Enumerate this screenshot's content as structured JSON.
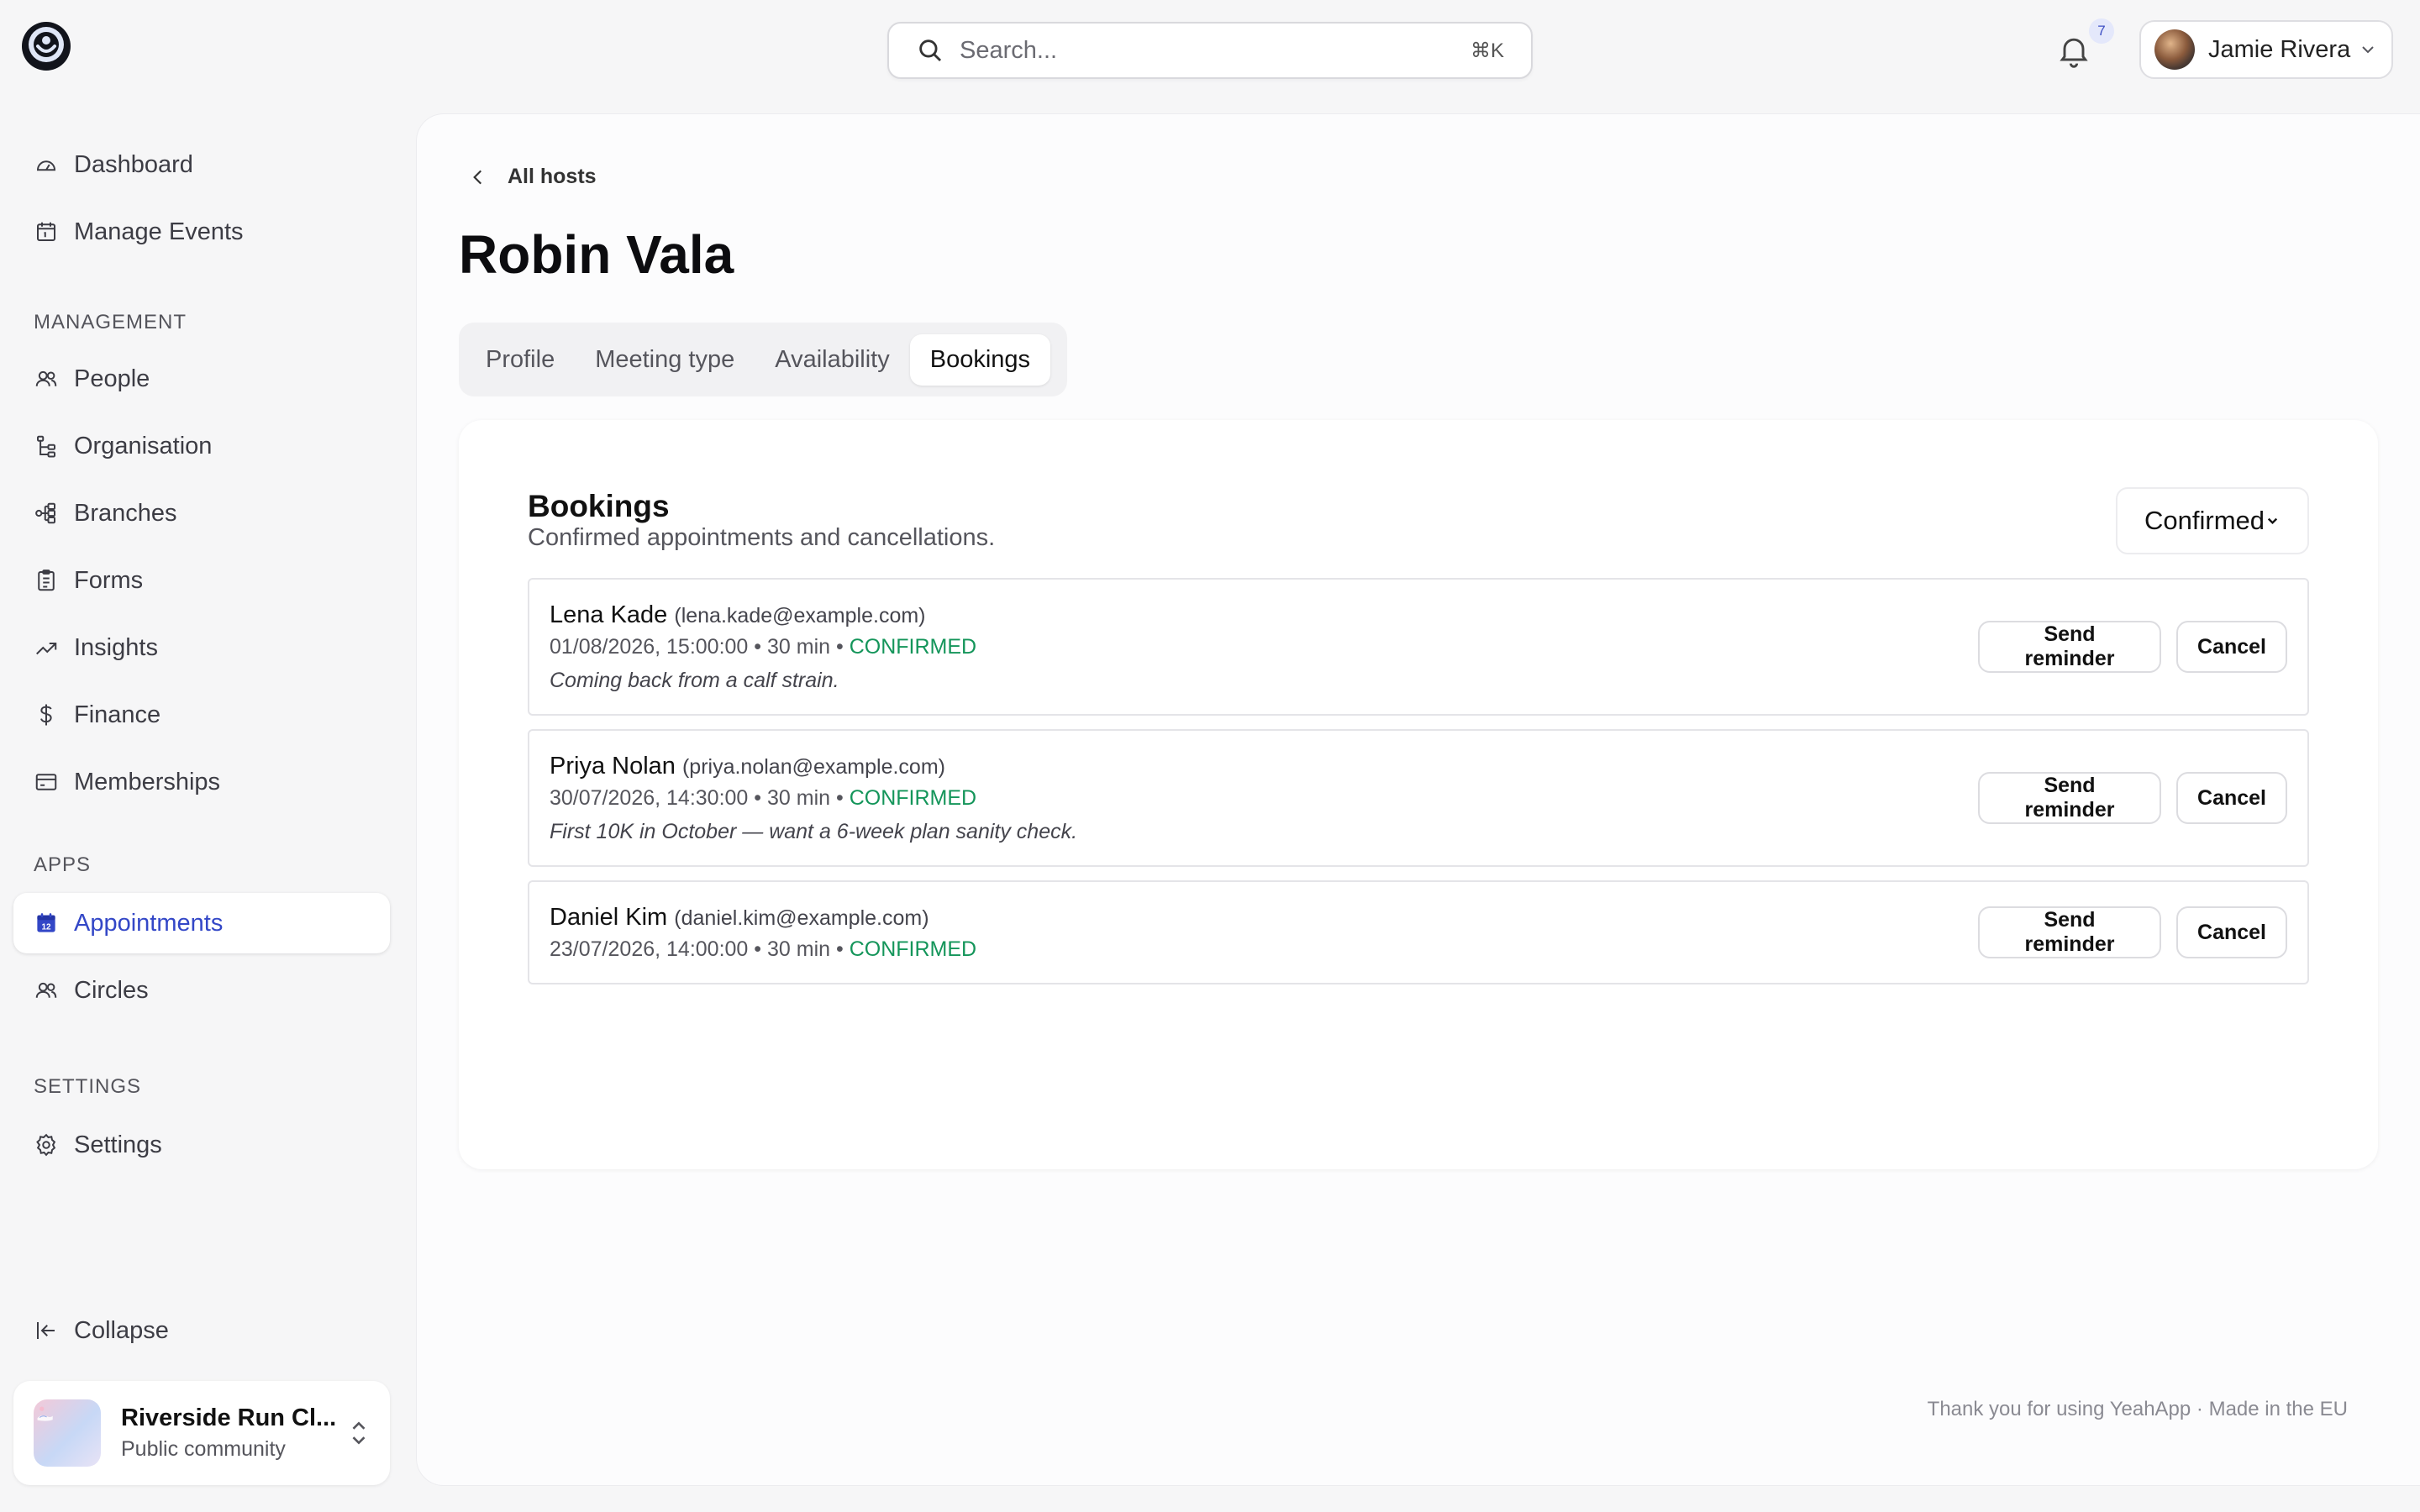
{
  "header": {
    "search_placeholder": "Search...",
    "search_shortcut": "⌘K",
    "notification_count": "7",
    "user_name": "Jamie Rivera"
  },
  "sidebar": {
    "top_items": [
      {
        "label": "Dashboard",
        "icon": "gauge-icon"
      },
      {
        "label": "Manage Events",
        "icon": "calendar-icon"
      }
    ],
    "management_label": "MANAGEMENT",
    "management_items": [
      {
        "label": "People",
        "icon": "people-icon"
      },
      {
        "label": "Organisation",
        "icon": "org-tree-icon"
      },
      {
        "label": "Branches",
        "icon": "branches-icon"
      },
      {
        "label": "Forms",
        "icon": "clipboard-icon"
      },
      {
        "label": "Insights",
        "icon": "trend-icon"
      },
      {
        "label": "Finance",
        "icon": "dollar-icon"
      },
      {
        "label": "Memberships",
        "icon": "card-icon"
      }
    ],
    "apps_label": "APPS",
    "apps_items": [
      {
        "label": "Appointments",
        "icon": "calendar-icon",
        "active": true
      },
      {
        "label": "Circles",
        "icon": "people-icon"
      }
    ],
    "settings_label": "SETTINGS",
    "settings_items": [
      {
        "label": "Settings",
        "icon": "gear-icon"
      }
    ],
    "collapse_label": "Collapse",
    "org": {
      "name": "Riverside Run Cl...",
      "subtitle": "Public community"
    }
  },
  "main": {
    "breadcrumb": "All hosts",
    "title": "Robin Vala",
    "tabs": [
      {
        "label": "Profile"
      },
      {
        "label": "Meeting type"
      },
      {
        "label": "Availability"
      },
      {
        "label": "Bookings",
        "active": true
      }
    ],
    "bookings": {
      "title": "Bookings",
      "subtitle": "Confirmed appointments and cancellations.",
      "filter_value": "Confirmed",
      "separator": "•",
      "reminder_label": "Send reminder",
      "cancel_label": "Cancel",
      "items": [
        {
          "name": "Lena Kade",
          "email": "(lena.kade@example.com)",
          "datetime": "01/08/2026, 15:00:00",
          "duration": "30 min",
          "status": "CONFIRMED",
          "note": "Coming back from a calf strain."
        },
        {
          "name": "Priya Nolan",
          "email": "(priya.nolan@example.com)",
          "datetime": "30/07/2026, 14:30:00",
          "duration": "30 min",
          "status": "CONFIRMED",
          "note": "First 10K in October — want a 6-week plan sanity check."
        },
        {
          "name": "Daniel Kim",
          "email": "(daniel.kim@example.com)",
          "datetime": "23/07/2026, 14:00:00",
          "duration": "30 min",
          "status": "CONFIRMED",
          "note": ""
        }
      ]
    },
    "footer": "Thank you for using YeahApp · Made in the EU"
  },
  "colors": {
    "accent": "#3347c7",
    "confirmed": "#14955a",
    "background": "#f6f6f7"
  }
}
